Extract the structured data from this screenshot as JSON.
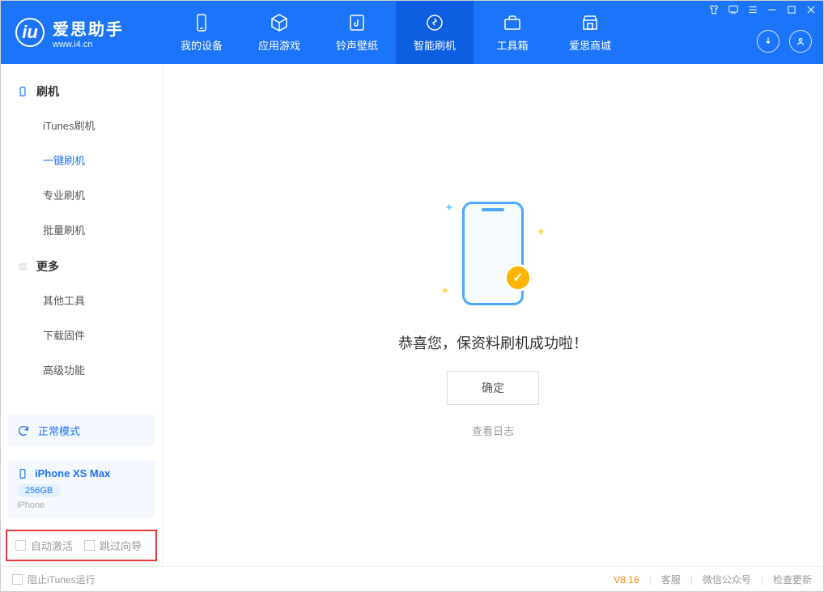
{
  "app": {
    "title": "爱思助手",
    "subtitle": "www.i4.cn"
  },
  "nav": {
    "items": [
      {
        "label": "我的设备"
      },
      {
        "label": "应用游戏"
      },
      {
        "label": "铃声壁纸"
      },
      {
        "label": "智能刷机"
      },
      {
        "label": "工具箱"
      },
      {
        "label": "爱思商城"
      }
    ]
  },
  "sidebar": {
    "group1": {
      "title": "刷机",
      "items": [
        "iTunes刷机",
        "一键刷机",
        "专业刷机",
        "批量刷机"
      ]
    },
    "group2": {
      "title": "更多",
      "items": [
        "其他工具",
        "下载固件",
        "高级功能"
      ]
    }
  },
  "device": {
    "mode": "正常模式",
    "name": "iPhone XS Max",
    "storage": "256GB",
    "type": "iPhone"
  },
  "options": {
    "auto_activate": "自动激活",
    "skip_guide": "跳过向导"
  },
  "main": {
    "success_msg": "恭喜您，保资料刷机成功啦！",
    "ok_label": "确定",
    "log_link": "查看日志"
  },
  "footer": {
    "block_itunes": "阻止iTunes运行",
    "version": "V8.16",
    "links": [
      "客服",
      "微信公众号",
      "检查更新"
    ]
  }
}
